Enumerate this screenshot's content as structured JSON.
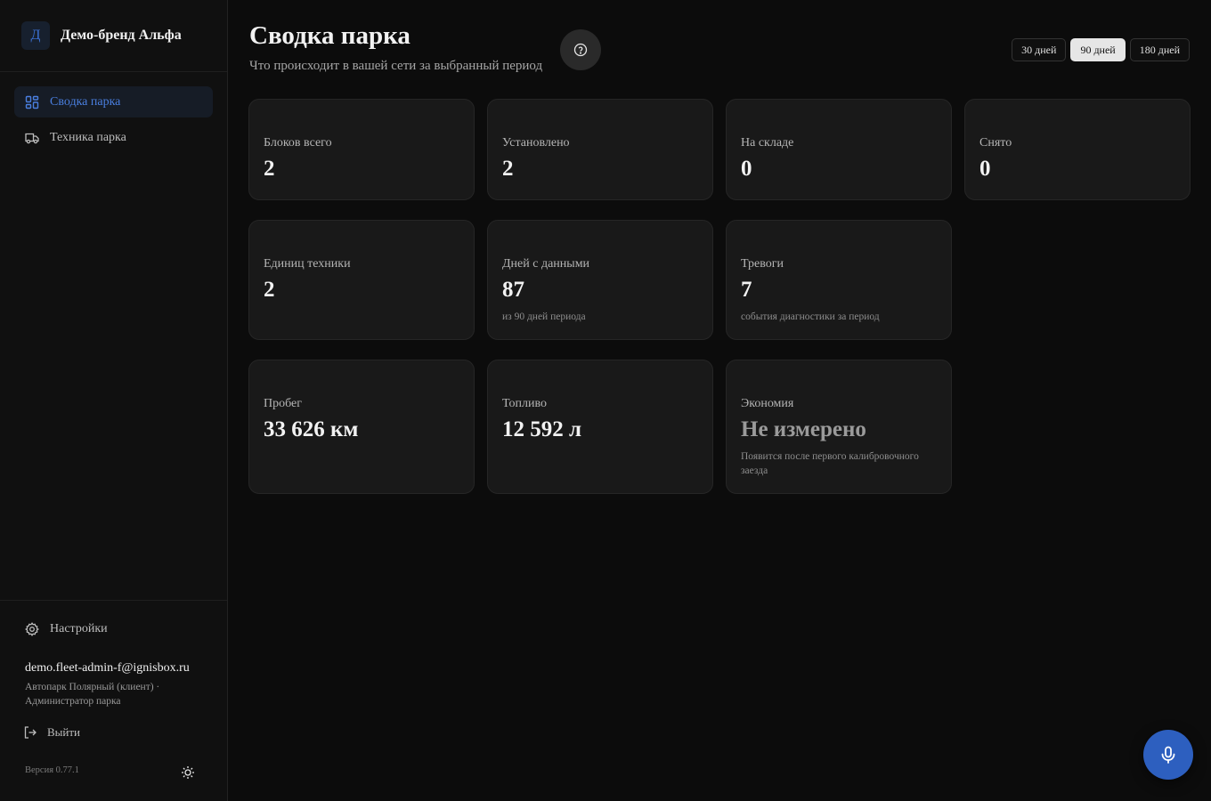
{
  "brand": {
    "logo_letter": "Д",
    "name": "Демо-бренд Альфа"
  },
  "sidebar": {
    "items": [
      {
        "label": "Сводка парка",
        "icon": "dashboard-grid-icon",
        "active": true
      },
      {
        "label": "Техника парка",
        "icon": "truck-icon",
        "active": false
      }
    ],
    "settings_label": "Настройки",
    "user_email": "demo.fleet-admin-f@ignisbox.ru",
    "user_org": "Автопарк Полярный (клиент) · Администратор парка",
    "logout_label": "Выйти",
    "version": "Версия 0.77.1"
  },
  "header": {
    "title": "Сводка парка",
    "subtitle": "Что происходит в вашей сети за выбранный период",
    "periods": [
      "30 дней",
      "90 дней",
      "180 дней"
    ],
    "selected_period": "90 дней"
  },
  "cards": {
    "blocks_total": {
      "label": "Блоков всего",
      "value": "2"
    },
    "installed": {
      "label": "Установлено",
      "value": "2"
    },
    "in_stock": {
      "label": "На складе",
      "value": "0"
    },
    "removed": {
      "label": "Снято",
      "value": "0"
    },
    "vehicles": {
      "label": "Единиц техники",
      "value": "2"
    },
    "days_with_data": {
      "label": "Дней с данными",
      "value": "87",
      "note": "из 90 дней периода"
    },
    "alarms": {
      "label": "Тревоги",
      "value": "7",
      "note": "события диагностики за период"
    },
    "mileage": {
      "label": "Пробег",
      "value": "33 626 км"
    },
    "fuel": {
      "label": "Топливо",
      "value": "12 592 л"
    },
    "savings": {
      "label": "Экономия",
      "value": "Не измерено",
      "note": "Появится после первого калибровочного заезда"
    }
  },
  "colors": {
    "accent": "#2d5fbf",
    "active_nav_text": "#4a7fe0",
    "background": "#0c0c0c",
    "card": "#191919"
  }
}
